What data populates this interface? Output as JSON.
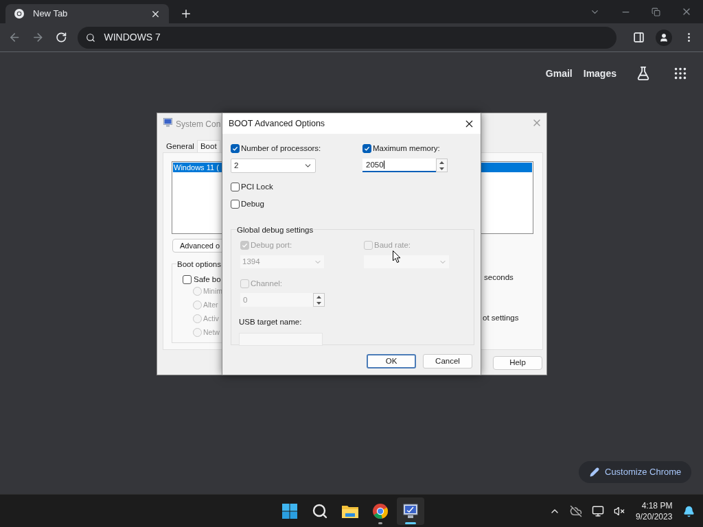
{
  "browser": {
    "tab": {
      "title": "New Tab"
    },
    "address": {
      "value": "WINDOWS 7"
    },
    "links": [
      "Gmail",
      "Images"
    ],
    "customize_button": "Customize Chrome"
  },
  "system_config": {
    "title": "System Con",
    "tabs": [
      {
        "label": "General",
        "selected": false
      },
      {
        "label": "Boot",
        "selected": true
      }
    ],
    "boot_entry": {
      "label": "Windows 11 (",
      "selected": true
    },
    "advanced_button": "Advanced o",
    "boot_options": {
      "title": "Boot options",
      "safe_boot": {
        "label": "Safe bo",
        "checked": false
      },
      "radios": [
        {
          "label": "Minim",
          "selected": false
        },
        {
          "label": "Alter",
          "selected": false
        },
        {
          "label": "Activ",
          "selected": false
        },
        {
          "label": "Netw",
          "selected": false
        }
      ]
    },
    "timeout_unit": "seconds",
    "permanent_label": "ot settings",
    "help_button": "Help"
  },
  "dialog": {
    "title": "BOOT Advanced Options",
    "processors": {
      "label": "Number of processors:",
      "checked": true,
      "value": "2"
    },
    "memory": {
      "label": "Maximum memory:",
      "checked": true,
      "value": "2050"
    },
    "pci_lock": {
      "label": "PCI Lock",
      "checked": false
    },
    "debug": {
      "label": "Debug",
      "checked": false
    },
    "group": {
      "title": "Global debug settings",
      "debug_port": {
        "label": "Debug port:",
        "checked": true,
        "disabled": true,
        "value": "1394"
      },
      "baud_rate": {
        "label": "Baud rate:",
        "checked": false,
        "disabled": true
      },
      "channel": {
        "label": "Channel:",
        "checked": false,
        "disabled": true,
        "value": "0"
      },
      "usb_target": {
        "label": "USB target name:",
        "disabled": true
      }
    },
    "buttons": [
      {
        "label": "OK",
        "kind": "default"
      },
      {
        "label": "Cancel",
        "kind": "normal"
      }
    ]
  },
  "taskbar": {
    "apps": [
      {
        "kind": "start",
        "open": false,
        "selected": false
      },
      {
        "kind": "search",
        "open": false,
        "selected": false
      },
      {
        "kind": "folder",
        "open": false,
        "selected": false
      },
      {
        "kind": "chrome",
        "open": true,
        "selected": false
      },
      {
        "kind": "sysconfig",
        "open": true,
        "selected": true
      }
    ],
    "clock": {
      "time": "4:18 PM",
      "date": "9/20/2023"
    }
  }
}
